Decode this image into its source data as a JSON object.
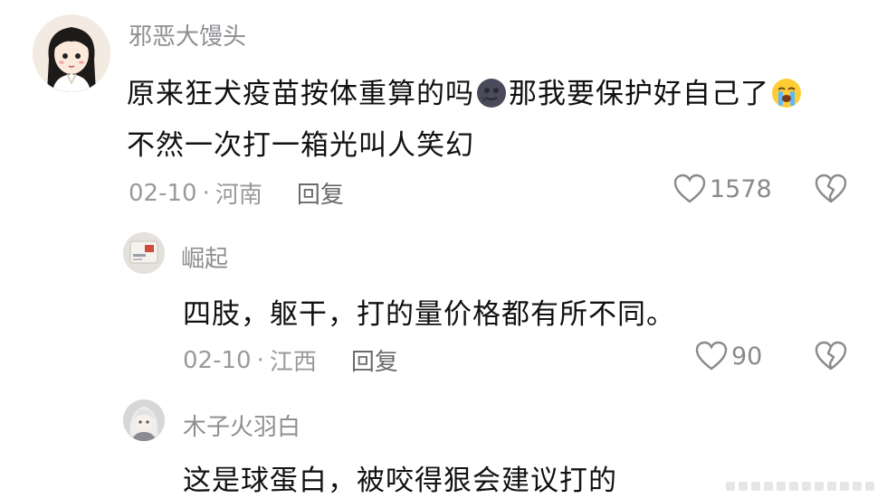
{
  "comments": [
    {
      "username": "邪恶大馒头",
      "text_part1": "原来狂犬疫苗按体重算的吗",
      "text_part2": "那我要保护好自己了",
      "text_line2": "不然一次打一箱光叫人笑幻",
      "emoji1": "new-moon-face-icon",
      "emoji2": "loudly-crying-face-icon",
      "date": "02-10",
      "separator": "·",
      "location": "河南",
      "reply_label": "回复",
      "likes": "1578"
    },
    {
      "username": "崛起",
      "text": "四肢，躯干，打的量价格都有所不同。",
      "date": "02-10",
      "separator": "·",
      "location": "江西",
      "reply_label": "回复",
      "likes": "90"
    },
    {
      "username": "木子火羽白",
      "text": "这是球蛋白，被咬得狠会建议打的"
    }
  ],
  "colors": {
    "username": "#8e8e93",
    "text": "#111111",
    "meta": "#9a9a9a",
    "icon": "#8a8a8a"
  }
}
